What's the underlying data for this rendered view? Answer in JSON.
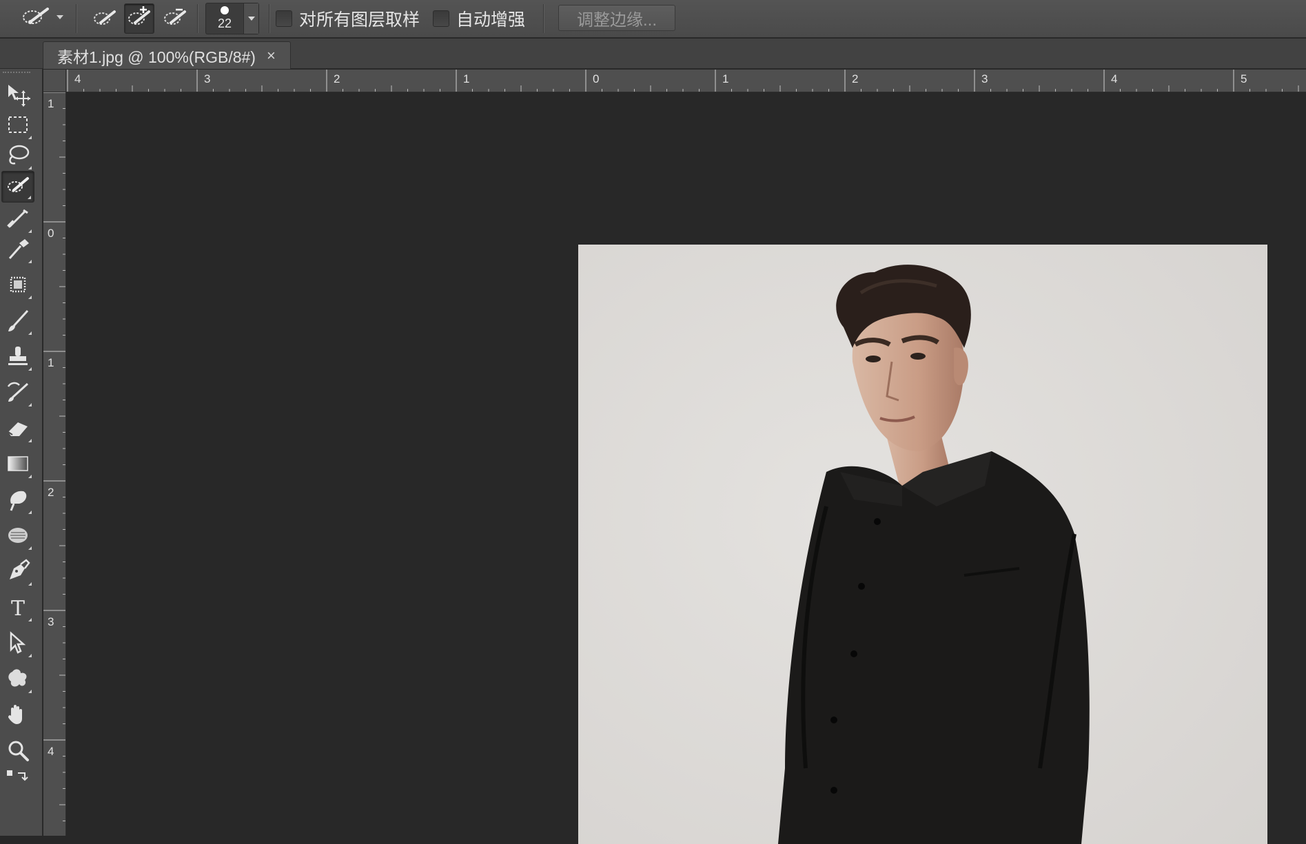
{
  "options_bar": {
    "tool_preset_icon": "quick-selection-icon",
    "mode_buttons": [
      {
        "name": "new-selection",
        "icon": "quick-selection-new-icon"
      },
      {
        "name": "add-to-selection",
        "icon": "quick-selection-add-icon",
        "active": true
      },
      {
        "name": "subtract-from-selection",
        "icon": "quick-selection-subtract-icon"
      }
    ],
    "brush_size": "22",
    "sample_all_layers_label": "对所有图层取样",
    "auto_enhance_label": "自动增强",
    "refine_edge_label": "调整边缘..."
  },
  "document_tab": {
    "title": "素材1.jpg @ 100%(RGB/8#)",
    "close_glyph": "×"
  },
  "toolbox": {
    "tools": [
      {
        "name": "move",
        "icon": "move-icon"
      },
      {
        "name": "rectangular-marquee",
        "icon": "marquee-icon"
      },
      {
        "name": "lasso",
        "icon": "lasso-icon"
      },
      {
        "name": "quick-selection",
        "icon": "quick-selection-icon",
        "active": true
      },
      {
        "name": "crop",
        "icon": "crop-icon"
      },
      {
        "name": "eyedropper",
        "icon": "eyedropper-icon"
      },
      {
        "name": "spot-healing",
        "icon": "healing-brush-icon"
      },
      {
        "name": "brush",
        "icon": "brush-icon"
      },
      {
        "name": "clone-stamp",
        "icon": "stamp-icon"
      },
      {
        "name": "history-brush",
        "icon": "history-brush-icon"
      },
      {
        "name": "eraser",
        "icon": "eraser-icon"
      },
      {
        "name": "gradient",
        "icon": "gradient-icon"
      },
      {
        "name": "blur",
        "icon": "blur-icon"
      },
      {
        "name": "dodge",
        "icon": "dodge-icon"
      },
      {
        "name": "pen",
        "icon": "pen-icon"
      },
      {
        "name": "type",
        "icon": "type-icon",
        "glyph": "T"
      },
      {
        "name": "path-selection",
        "icon": "path-selection-icon"
      },
      {
        "name": "custom-shape",
        "icon": "custom-shape-icon"
      },
      {
        "name": "hand",
        "icon": "hand-icon"
      },
      {
        "name": "zoom",
        "icon": "zoom-icon"
      },
      {
        "name": "swap-colors",
        "icon": "swap-colors-icon"
      }
    ]
  },
  "rulers": {
    "horizontal_labels": [
      "4",
      "3",
      "2",
      "1",
      "0",
      "1",
      "2",
      "3",
      "4",
      "5"
    ],
    "vertical_labels": [
      "1",
      "0",
      "1",
      "2",
      "3",
      "4"
    ]
  },
  "colors": {
    "ui_panel": "#4c4c4c",
    "canvas_bg": "#282828",
    "photo_bg": "#dcdad8"
  }
}
